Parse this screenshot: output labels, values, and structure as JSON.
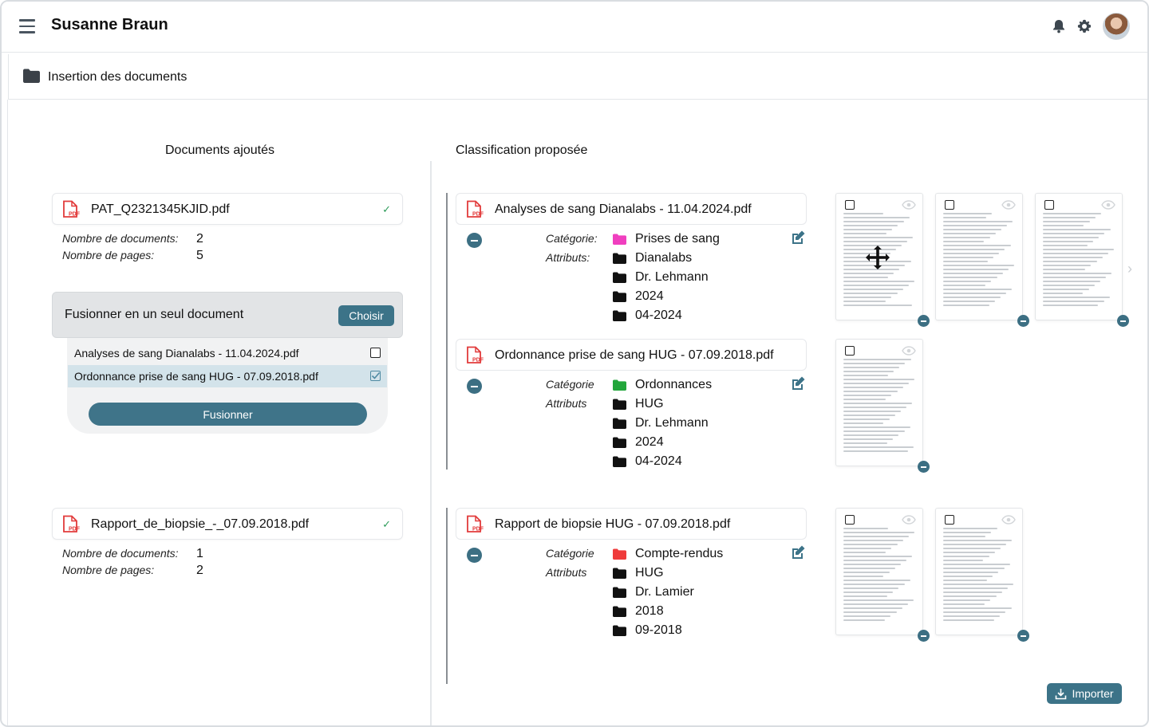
{
  "header": {
    "user_name": "Susanne Braun"
  },
  "section": {
    "title": "Insertion des documents"
  },
  "left": {
    "title": "Documents ajoutés",
    "docs": [
      {
        "filename": "PAT_Q2321345KJID.pdf",
        "docs_label": "Nombre de documents:",
        "docs_count": "2",
        "pages_label": "Nombre de pages:",
        "pages_count": "5"
      },
      {
        "filename": "Rapport_de_biopsie_-_07.09.2018.pdf",
        "docs_label": "Nombre de documents:",
        "docs_count": "1",
        "pages_label": "Nombre de pages:",
        "pages_count": "2"
      }
    ],
    "merge": {
      "title": "Fusionner en un seul document",
      "choose_label": "Choisir",
      "items": [
        {
          "label": "Analyses de sang Dianalabs - 11.04.2024.pdf",
          "checked": false
        },
        {
          "label": "Ordonnance prise de sang HUG - 07.09.2018.pdf",
          "checked": true
        }
      ],
      "button_label": "Fusionner"
    }
  },
  "right": {
    "title": "Classification proposée",
    "groups": [
      {
        "filename": "Analyses de sang Dianalabs - 11.04.2024.pdf",
        "category_label": "Catégorie:",
        "attributes_label": "Attributs:",
        "values": [
          {
            "text": "Prises de sang",
            "color": "#f03fbf"
          },
          {
            "text": "Dianalabs",
            "color": "#111111"
          },
          {
            "text": "Dr. Lehmann",
            "color": "#111111"
          },
          {
            "text": "2024",
            "color": "#111111"
          },
          {
            "text": "04-2024",
            "color": "#111111"
          }
        ]
      },
      {
        "filename": "Ordonnance prise de sang HUG - 07.09.2018.pdf",
        "category_label": "Catégorie",
        "attributes_label": "Attributs",
        "values": [
          {
            "text": "Ordonnances",
            "color": "#22a63b"
          },
          {
            "text": "HUG",
            "color": "#111111"
          },
          {
            "text": "Dr. Lehmann",
            "color": "#111111"
          },
          {
            "text": "2024",
            "color": "#111111"
          },
          {
            "text": "04-2024",
            "color": "#111111"
          }
        ]
      },
      {
        "filename": "Rapport de biopsie HUG - 07.09.2018.pdf",
        "category_label": "Catégorie",
        "attributes_label": "Attributs",
        "values": [
          {
            "text": "Compte-rendus",
            "color": "#ef3b3b"
          },
          {
            "text": "HUG",
            "color": "#111111"
          },
          {
            "text": "Dr. Lamier",
            "color": "#111111"
          },
          {
            "text": "2018",
            "color": "#111111"
          },
          {
            "text": "09-2018",
            "color": "#111111"
          }
        ]
      }
    ],
    "import_label": "Importer"
  },
  "colors": {
    "accent": "#3c7388",
    "pdf_red": "#e23b3b",
    "check_green": "#2e9c5a"
  }
}
